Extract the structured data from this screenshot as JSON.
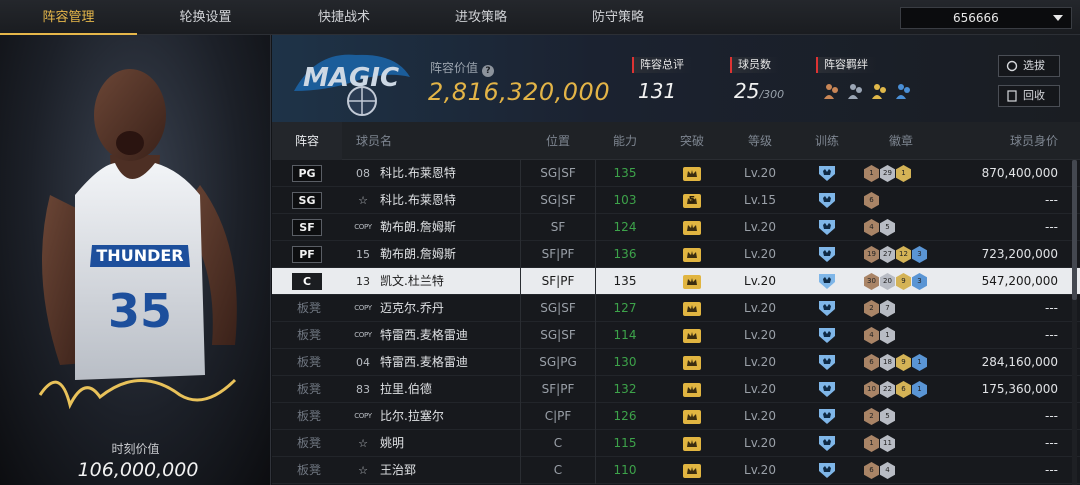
{
  "tabs": [
    {
      "label": "阵容管理",
      "active": true
    },
    {
      "label": "轮换设置",
      "active": false
    },
    {
      "label": "快捷战术",
      "active": false
    },
    {
      "label": "进攻策略",
      "active": false
    },
    {
      "label": "防守策略",
      "active": false
    }
  ],
  "team_select": {
    "value": "656666"
  },
  "player_card": {
    "value_label": "时刻价值",
    "value": "106,000,000",
    "jersey_text": "THUNDER",
    "jersey_number": "35"
  },
  "team_header": {
    "lineup_value_label": "阵容价值",
    "lineup_value": "2,816,320,000",
    "overall_label": "阵容总评",
    "overall_value": "131",
    "player_count_label": "球员数",
    "player_count_value": "25",
    "player_count_max": "/300",
    "bond_label": "阵容羁绊",
    "select_btn": "选拔",
    "recycle_btn": "回收",
    "logo_text": "MAGIC"
  },
  "table": {
    "headers": {
      "lineup": "阵容",
      "name": "球员名",
      "position": "位置",
      "ability": "能力",
      "breakthrough": "突破",
      "level": "等级",
      "training": "训练",
      "badges": "徽章",
      "value": "球员身价"
    },
    "rows": [
      {
        "slot": "PG",
        "starter": true,
        "jersey": "08",
        "name": "科比.布莱恩特",
        "position": "SG|SF",
        "ability": "135",
        "break": "",
        "level": "Lv.20",
        "badges": [
          "1",
          "29",
          "1"
        ],
        "value": "870,400,000"
      },
      {
        "slot": "SG",
        "starter": true,
        "jersey": "☆",
        "name": "科比.布莱恩特",
        "position": "SG|SF",
        "ability": "103",
        "break": "5",
        "level": "Lv.15",
        "badges": [
          "6"
        ],
        "value": "---"
      },
      {
        "slot": "SF",
        "starter": true,
        "jersey": "COPY",
        "name": "勒布朗.詹姆斯",
        "position": "SF",
        "ability": "124",
        "break": "",
        "level": "Lv.20",
        "badges": [
          "4",
          "5"
        ],
        "value": "---"
      },
      {
        "slot": "PF",
        "starter": true,
        "jersey": "15",
        "name": "勒布朗.詹姆斯",
        "position": "SF|PF",
        "ability": "136",
        "break": "",
        "level": "Lv.20",
        "badges": [
          "19",
          "27",
          "12",
          "3"
        ],
        "value": "723,200,000"
      },
      {
        "slot": "C",
        "starter": true,
        "selected": true,
        "jersey": "13",
        "name": "凯文.杜兰特",
        "position": "SF|PF",
        "ability": "135",
        "break": "",
        "level": "Lv.20",
        "badges": [
          "30",
          "20",
          "9",
          "3"
        ],
        "value": "547,200,000"
      },
      {
        "slot": "板凳",
        "starter": false,
        "jersey": "COPY",
        "name": "迈克尔.乔丹",
        "position": "SG|SF",
        "ability": "127",
        "break": "",
        "level": "Lv.20",
        "badges": [
          "2",
          "7"
        ],
        "value": "---"
      },
      {
        "slot": "板凳",
        "starter": false,
        "jersey": "COPY",
        "name": "特雷西.麦格雷迪",
        "position": "SG|SF",
        "ability": "114",
        "break": "",
        "level": "Lv.20",
        "badges": [
          "4",
          "1"
        ],
        "value": "---"
      },
      {
        "slot": "板凳",
        "starter": false,
        "jersey": "04",
        "name": "特雷西.麦格雷迪",
        "position": "SG|PG",
        "ability": "130",
        "break": "",
        "level": "Lv.20",
        "badges": [
          "6",
          "18",
          "9",
          "1"
        ],
        "value": "284,160,000"
      },
      {
        "slot": "板凳",
        "starter": false,
        "jersey": "83",
        "name": "拉里.伯德",
        "position": "SF|PF",
        "ability": "132",
        "break": "",
        "level": "Lv.20",
        "badges": [
          "10",
          "22",
          "6",
          "1"
        ],
        "value": "175,360,000"
      },
      {
        "slot": "板凳",
        "starter": false,
        "jersey": "COPY",
        "name": "比尔.拉塞尔",
        "position": "C|PF",
        "ability": "126",
        "break": "",
        "level": "Lv.20",
        "badges": [
          "2",
          "5"
        ],
        "value": "---"
      },
      {
        "slot": "板凳",
        "starter": false,
        "jersey": "☆",
        "name": "姚明",
        "position": "C",
        "ability": "115",
        "break": "",
        "level": "Lv.20",
        "badges": [
          "1",
          "11"
        ],
        "value": "---"
      },
      {
        "slot": "板凳",
        "starter": false,
        "jersey": "☆",
        "name": "王治郅",
        "position": "C",
        "ability": "110",
        "break": "",
        "level": "Lv.20",
        "badges": [
          "6",
          "4"
        ],
        "value": "---"
      }
    ]
  },
  "colors": {
    "accent": "#e6b74a",
    "ability_green": "#3da34a",
    "highlight_row": "#e9ebee"
  }
}
